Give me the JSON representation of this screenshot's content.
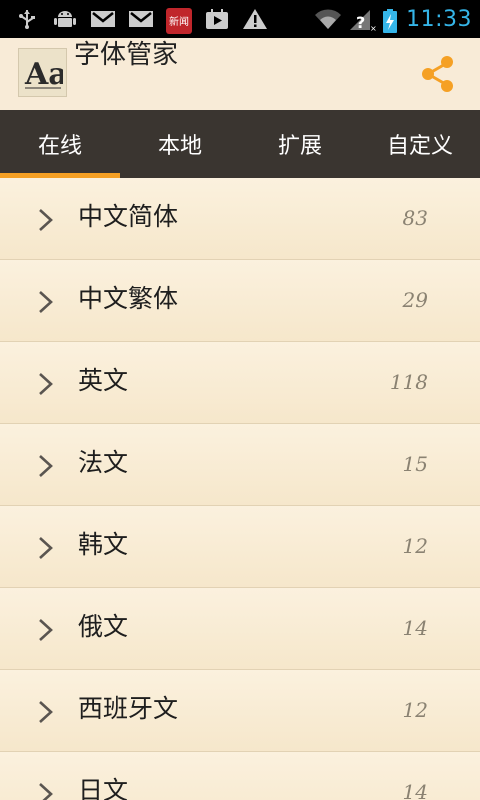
{
  "status_bar": {
    "time": "11:33",
    "icons": [
      "usb-icon",
      "android-debug-icon",
      "gmail-icon",
      "gmail-icon",
      "news-app-icon",
      "play-store-icon",
      "warning-icon",
      "wifi-icon",
      "signal-icon",
      "battery-icon"
    ],
    "news_icon_text": "新闻"
  },
  "header": {
    "title": "字体管家",
    "logo_text": "Aa",
    "accent_color": "#f5a024"
  },
  "tabs": [
    {
      "label": "在线",
      "active": true
    },
    {
      "label": "本地",
      "active": false
    },
    {
      "label": "扩展",
      "active": false
    },
    {
      "label": "自定义",
      "active": false
    }
  ],
  "categories": [
    {
      "label": "中文简体",
      "count": "83"
    },
    {
      "label": "中文繁体",
      "count": "29"
    },
    {
      "label": "英文",
      "count": "118"
    },
    {
      "label": "法文",
      "count": "15"
    },
    {
      "label": "韩文",
      "count": "12"
    },
    {
      "label": "俄文",
      "count": "14"
    },
    {
      "label": "西班牙文",
      "count": "12"
    },
    {
      "label": "日文",
      "count": "14"
    }
  ]
}
